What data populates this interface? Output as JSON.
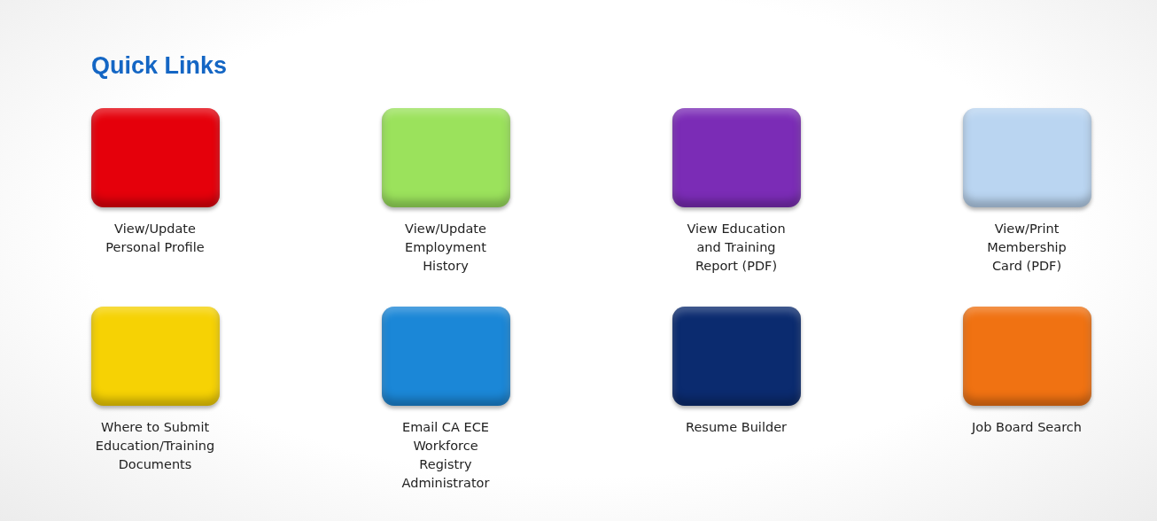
{
  "title": "Quick Links",
  "links": [
    {
      "label": "View/Update\nPersonal Profile",
      "color": "#e5000b"
    },
    {
      "label": "View/Update\nEmployment\nHistory",
      "color": "#9be25c"
    },
    {
      "label": "View Education\nand Training\nReport (PDF)",
      "color": "#7b2cb6"
    },
    {
      "label": "View/Print\nMembership\nCard (PDF)",
      "color": "#bad5f1"
    },
    {
      "label": "Where to Submit\nEducation/Training\nDocuments",
      "color": "#f6d204"
    },
    {
      "label": "Email CA ECE\nWorkforce\nRegistry\nAdministrator",
      "color": "#1b87d7"
    },
    {
      "label": "Resume Builder",
      "color": "#0b2b6f"
    },
    {
      "label": "Job Board Search",
      "color": "#f07212"
    }
  ]
}
